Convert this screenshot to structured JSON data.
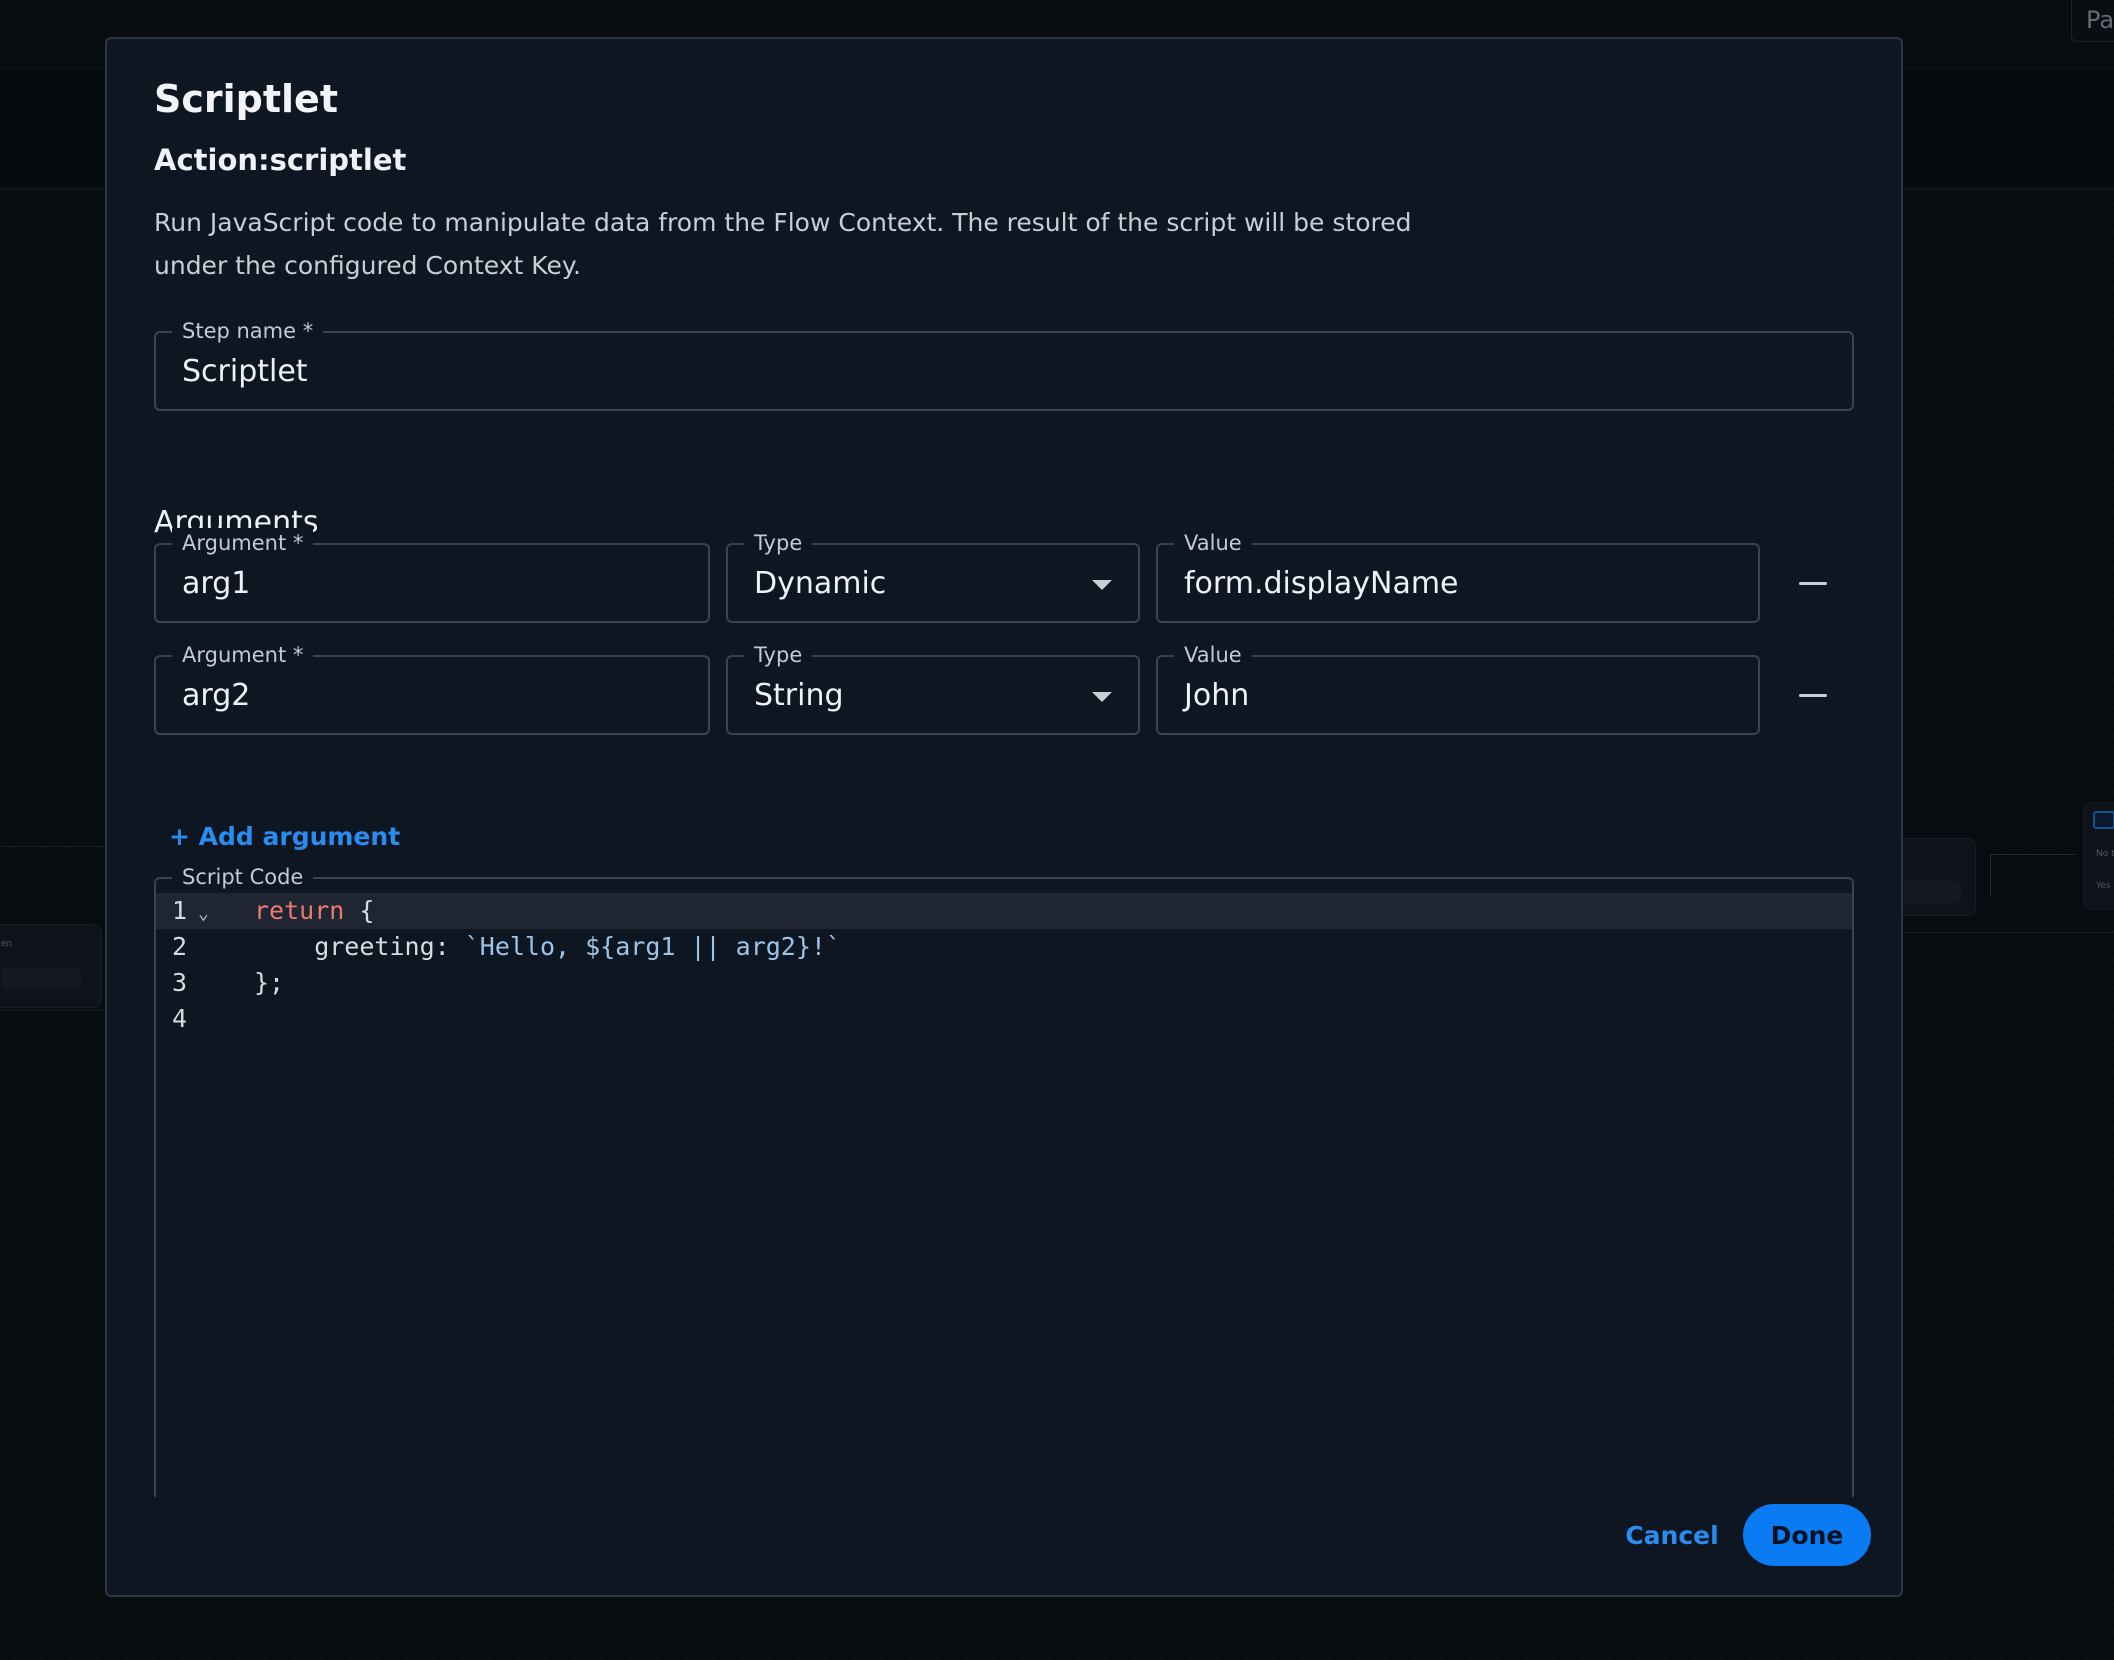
{
  "background": {
    "top_button_label": "Pa",
    "node_left_text": "en",
    "node_right_texts": [
      "No t",
      "Yes"
    ]
  },
  "modal": {
    "title": "Scriptlet",
    "subtitle": "Action:scriptlet",
    "description": "Run JavaScript code to manipulate data from the Flow Context. The result of the script will be stored under the configured Context Key.",
    "step_name": {
      "label": "Step name *",
      "value": "Scriptlet"
    },
    "arguments_title": "Arguments",
    "arguments": [
      {
        "argument_label": "Argument *",
        "argument_value": "arg1",
        "type_label": "Type",
        "type_value": "Dynamic",
        "value_label": "Value",
        "value": "form.displayName"
      },
      {
        "argument_label": "Argument *",
        "argument_value": "arg2",
        "type_label": "Type",
        "type_value": "String",
        "value_label": "Value",
        "value": "John"
      }
    ],
    "add_argument_label": "+ Add argument",
    "script_code": {
      "label": "Script Code",
      "lines": [
        {
          "number": "1",
          "keyword": "return",
          "rest": " {"
        },
        {
          "number": "2",
          "indent": "    greeting: ",
          "string": "`Hello, ${arg1 || arg2}!`"
        },
        {
          "number": "3",
          "text": "};"
        },
        {
          "number": "4",
          "text": ""
        }
      ]
    },
    "cancel_label": "Cancel",
    "done_label": "Done"
  },
  "colors": {
    "accent": "#0a7bf2",
    "link": "#2a8cf0",
    "modal_bg": "#0e1621",
    "keyword": "#ea7a72",
    "string": "#9ec3e8"
  }
}
